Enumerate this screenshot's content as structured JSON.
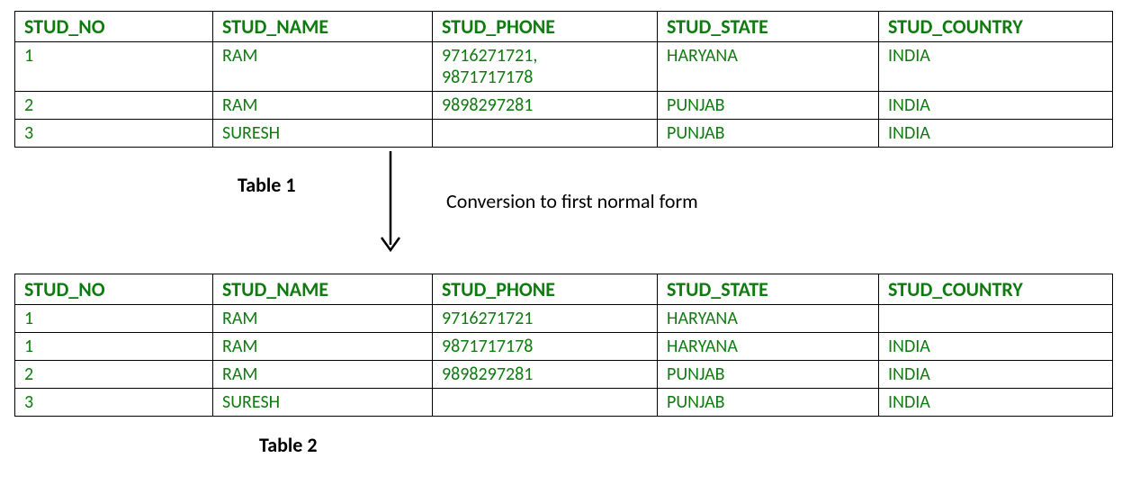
{
  "chart_data": [
    {
      "type": "table",
      "title": "Table 1",
      "headers": [
        "STUD_NO",
        "STUD_NAME",
        "STUD_PHONE",
        "STUD_STATE",
        "STUD_COUNTRY"
      ],
      "rows": [
        [
          "1",
          "RAM",
          "9716271721,\n9871717178",
          "HARYANA",
          "INDIA"
        ],
        [
          "2",
          "RAM",
          "9898297281",
          "PUNJAB",
          "INDIA"
        ],
        [
          "3",
          "SURESH",
          "",
          "PUNJAB",
          "INDIA"
        ]
      ]
    },
    {
      "type": "table",
      "title": "Table 2",
      "headers": [
        "STUD_NO",
        "STUD_NAME",
        "STUD_PHONE",
        "STUD_STATE",
        "STUD_COUNTRY"
      ],
      "rows": [
        [
          "1",
          "RAM",
          "9716271721",
          "HARYANA",
          ""
        ],
        [
          "1",
          "RAM",
          "9871717178",
          "HARYANA",
          "INDIA"
        ],
        [
          "2",
          "RAM",
          "9898297281",
          "PUNJAB",
          "INDIA"
        ],
        [
          "3",
          "SURESH",
          "",
          "PUNJAB",
          "INDIA"
        ]
      ]
    }
  ],
  "table1": {
    "caption": "Table 1",
    "headers": {
      "no": "STUD_NO",
      "name": "STUD_NAME",
      "phone": "STUD_PHONE",
      "state": "STUD_STATE",
      "country": "STUD_COUNTRY"
    },
    "rows": [
      {
        "no": "1",
        "name": "RAM",
        "phone_line1": "9716271721,",
        "phone_line2": "9871717178",
        "state": "HARYANA",
        "country": "INDIA"
      },
      {
        "no": "2",
        "name": "RAM",
        "phone_line1": "9898297281",
        "phone_line2": "",
        "state": "PUNJAB",
        "country": "INDIA"
      },
      {
        "no": "3",
        "name": "SURESH",
        "phone_line1": "",
        "phone_line2": "",
        "state": "PUNJAB",
        "country": "INDIA"
      }
    ]
  },
  "conversion_label": "Conversion to first normal form",
  "table2": {
    "caption": "Table 2",
    "headers": {
      "no": "STUD_NO",
      "name": "STUD_NAME",
      "phone": "STUD_PHONE",
      "state": "STUD_STATE",
      "country": "STUD_COUNTRY"
    },
    "rows": [
      {
        "no": "1",
        "name": "RAM",
        "phone": "9716271721",
        "state": "HARYANA",
        "country": ""
      },
      {
        "no": "1",
        "name": "RAM",
        "phone": "9871717178",
        "state": "HARYANA",
        "country": "INDIA"
      },
      {
        "no": "2",
        "name": "RAM",
        "phone": "9898297281",
        "state": "PUNJAB",
        "country": "INDIA"
      },
      {
        "no": "3",
        "name": "SURESH",
        "phone": "",
        "state": "PUNJAB",
        "country": "INDIA"
      }
    ]
  }
}
